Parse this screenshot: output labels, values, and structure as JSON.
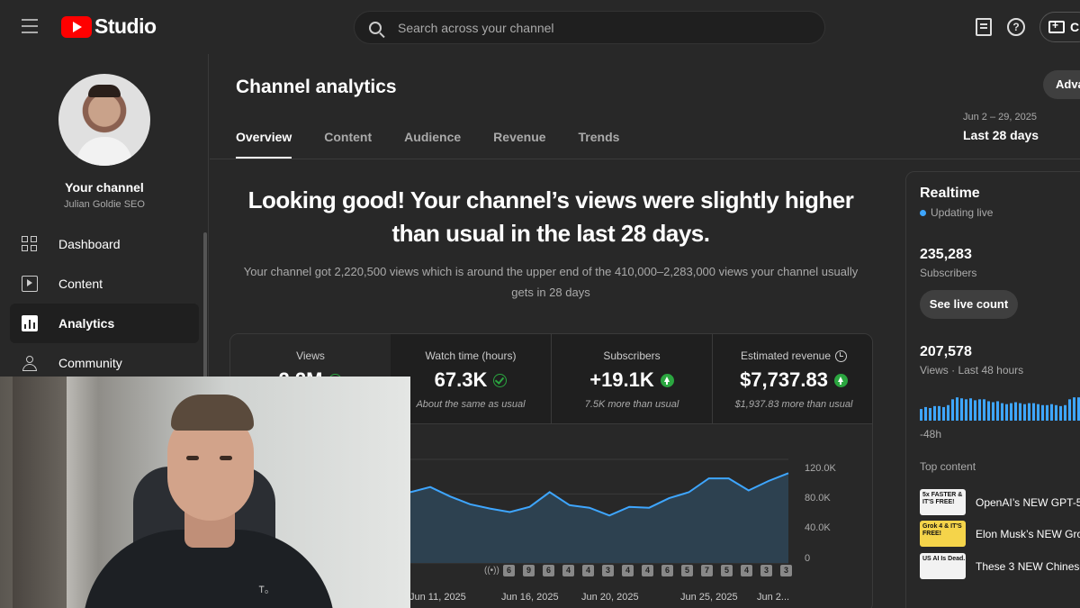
{
  "header": {
    "app_name": "Studio",
    "search_placeholder": "Search across your channel",
    "create_label": "C",
    "help_glyph": "?"
  },
  "sidebar": {
    "channel_label": "Your channel",
    "channel_name": "Julian Goldie SEO",
    "items": [
      {
        "label": "Dashboard",
        "icon": "dashboard-icon"
      },
      {
        "label": "Content",
        "icon": "content-icon"
      },
      {
        "label": "Analytics",
        "icon": "analytics-icon"
      },
      {
        "label": "Community",
        "icon": "community-icon"
      }
    ]
  },
  "main": {
    "title": "Channel analytics",
    "advanced_label": "Adva",
    "tabs": [
      "Overview",
      "Content",
      "Audience",
      "Revenue",
      "Trends"
    ],
    "date_range": "Jun 2 – 29, 2025",
    "date_label": "Last 28 days",
    "headline": "Looking good! Your channel’s views were slightly higher than usual in the last 28 days.",
    "subline": "Your channel got 2,220,500 views which is around the upper end of the 410,000–2,283,000 views your channel usually gets in 28 days",
    "metrics": [
      {
        "label": "Views",
        "value": "2.2M",
        "note": ""
      },
      {
        "label": "Watch time (hours)",
        "value": "67.3K",
        "note": "About the same as usual"
      },
      {
        "label": "Subscribers",
        "value": "+19.1K",
        "note": "7.5K more than usual"
      },
      {
        "label": "Estimated revenue",
        "value": "$7,737.83",
        "note": "$1,937.83 more than usual"
      }
    ],
    "marker_labels": [
      "6",
      "9",
      "6",
      "4",
      "4",
      "3",
      "4",
      "4",
      "6",
      "5",
      "7",
      "5",
      "4",
      "3",
      "3"
    ]
  },
  "chart_data": {
    "type": "area",
    "y_ticks": [
      "120.0K",
      "80.0K",
      "40.0K",
      "0"
    ],
    "ylim": [
      0,
      120000
    ],
    "x_tick_labels": [
      "Jun 11, 2025",
      "Jun 16, 2025",
      "Jun 20, 2025",
      "Jun 25, 2025",
      "Jun 2..."
    ],
    "x": [
      "Jun 10",
      "Jun 11",
      "Jun 12",
      "Jun 13",
      "Jun 14",
      "Jun 15",
      "Jun 16",
      "Jun 17",
      "Jun 18",
      "Jun 19",
      "Jun 20",
      "Jun 21",
      "Jun 22",
      "Jun 23",
      "Jun 24",
      "Jun 25",
      "Jun 26",
      "Jun 27",
      "Jun 28",
      "Jun 29"
    ],
    "values": [
      82000,
      88000,
      77000,
      68000,
      63000,
      59000,
      65000,
      82000,
      67000,
      64000,
      55000,
      65000,
      64000,
      75000,
      82000,
      98000,
      98000,
      84000,
      95000,
      104000
    ],
    "line_color": "#3ea6ff",
    "fill_color": "#2d4150"
  },
  "realtime": {
    "title": "Realtime",
    "status": "Updating live",
    "subscribers": "235,283",
    "subscribers_label": "Subscribers",
    "live_count_label": "See live count",
    "views": "207,578",
    "views_label": "Views · Last 48 hours",
    "axis_label": "-48h",
    "bar_values": [
      12,
      14,
      13,
      15,
      15,
      14,
      16,
      22,
      24,
      23,
      22,
      23,
      21,
      22,
      22,
      20,
      19,
      20,
      18,
      17,
      18,
      19,
      18,
      17,
      18,
      18,
      17,
      16,
      16,
      17,
      16,
      15,
      16,
      22,
      24,
      24,
      23,
      24,
      22,
      21
    ],
    "bar_color": "#3ea6ff",
    "top_content_label": "Top content",
    "top_items": [
      {
        "title": "OpenAI’s NEW GPT-5 is",
        "thumb_text": "5x FASTER & IT'S FREE!",
        "thumb_color": "#f2f2f2"
      },
      {
        "title": "Elon Musk’s NEW Grok",
        "thumb_text": "Grok 4 & IT'S FREE!",
        "thumb_color": "#f5d44a"
      },
      {
        "title": "These 3 NEW Chinese",
        "thumb_text": "US AI Is Dead.",
        "thumb_color": "#f2f2f2"
      }
    ]
  },
  "webcam": {
    "signature": "Ꭲ₀"
  }
}
